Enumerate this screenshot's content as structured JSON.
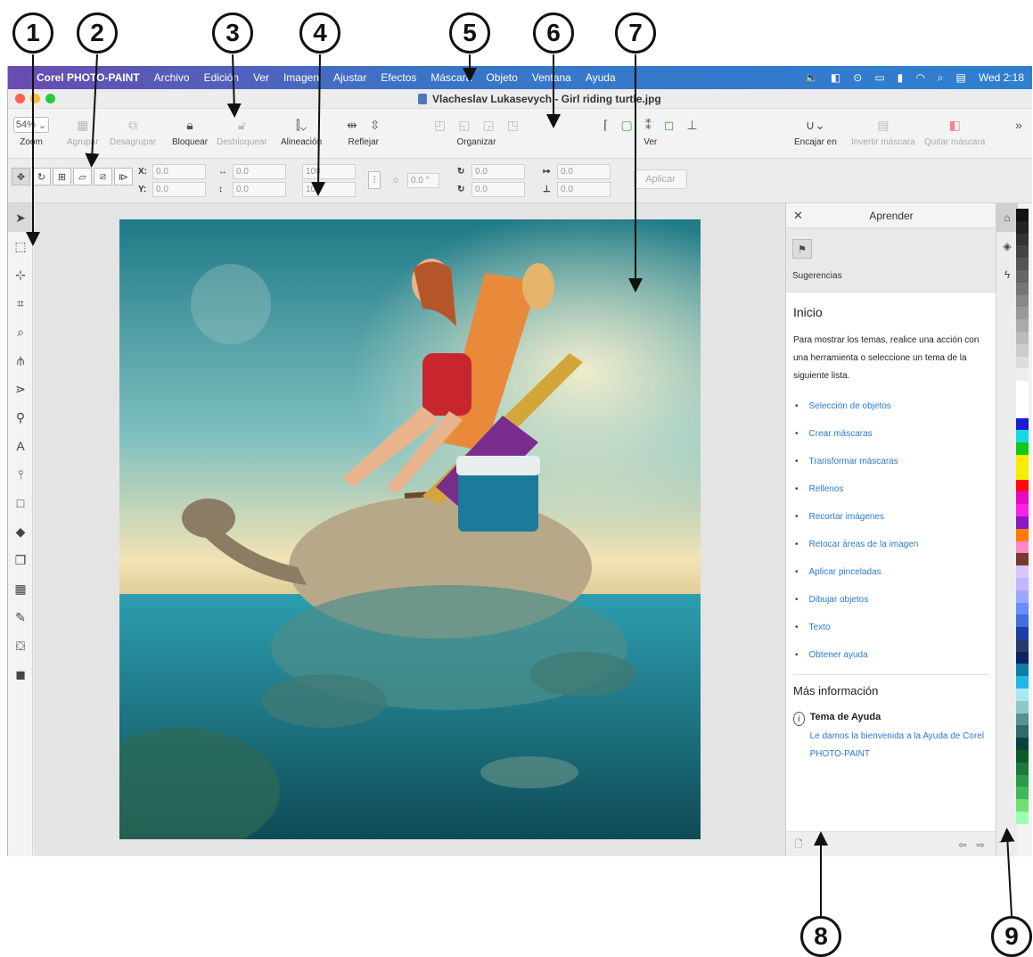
{
  "callouts": [
    "1",
    "2",
    "3",
    "4",
    "5",
    "6",
    "7",
    "8",
    "9"
  ],
  "menubar": {
    "app_name": "Corel PHOTO-PAINT",
    "items": [
      "Archivo",
      "Edición",
      "Ver",
      "Imagen",
      "Ajustar",
      "Efectos",
      "Máscara",
      "Objeto",
      "Ventana",
      "Ayuda"
    ],
    "clock": "Wed 2:18"
  },
  "titlebar": {
    "document_title": "Vlacheslav Lukasevych - Girl riding turtle.jpg"
  },
  "propbar": {
    "zoom_value": "54%",
    "zoom_label": "Zoom",
    "group_label": "Agrupar",
    "ungroup_label": "Desagrupar",
    "lock_label": "Bloquear",
    "unlock_label": "Desbloquear",
    "align_label": "Alineación",
    "mirror_label": "Reflejar",
    "arrange_label": "Organizar",
    "view_label": "Ver",
    "snap_label": "Encajar en",
    "invert_mask_label": "Invertir máscara",
    "remove_mask_label": "Quitar máscara"
  },
  "toolbar2": {
    "x_label": "X:",
    "x_value": "0.0",
    "y_label": "Y:",
    "y_value": "0.0",
    "w_value": "0.0",
    "h_value": "0.0",
    "sw_value": "100",
    "sh_value": "100",
    "angle_value": "0.0 °",
    "rx_value": "0.0",
    "ry_value": "0.0",
    "sx_value": "0.0",
    "sy_value": "0.0",
    "apply_label": "Aplicar"
  },
  "dock": {
    "title": "Aprender",
    "tips_label": "Sugerencias",
    "heading": "Inicio",
    "intro": "Para mostrar los temas, realice una acción con una herramienta o seleccione un tema de la siguiente lista.",
    "topics": [
      "Selección de objetos",
      "Crear máscaras",
      "Transformar máscaras",
      "Rellenos",
      "Recortar imágenes",
      "Retocar áreas de la imagen",
      "Aplicar pinceladas",
      "Dibujar objetos",
      "Texto",
      "Obtener ayuda"
    ],
    "more_heading": "Más información",
    "help_title": "Tema de Ayuda",
    "help_link": "Le damos la bienvenida a la Ayuda de Corel PHOTO-PAINT"
  },
  "colors": {
    "accent": "#3a78c5",
    "link": "#2a7ad8",
    "palette": [
      "#111111",
      "#222222",
      "#333333",
      "#444444",
      "#555555",
      "#666666",
      "#777777",
      "#888888",
      "#999999",
      "#aaaaaa",
      "#bbbbbb",
      "#cccccc",
      "#dddddd",
      "#eeeeee",
      "#ffffff",
      "#ffffff",
      "#ffffff",
      "#1b1bd8",
      "#11dbe6",
      "#15c81a",
      "#ffeb00",
      "#f0f000",
      "#ff0a0a",
      "#e80ac3",
      "#ff20e8",
      "#8a1abf",
      "#ff7a00",
      "#ff89c6",
      "#7a3b2e",
      "#d6c8ff",
      "#c4b5ff",
      "#9aa8ff",
      "#6a8cff",
      "#3f6fe0",
      "#1a3fa8",
      "#2a3a70",
      "#0d2462",
      "#0f7ca8",
      "#1fb6e8",
      "#a8e8f4",
      "#8cc8c8",
      "#5a9090",
      "#2f6b6b",
      "#0a4040",
      "#0a5a2a",
      "#1b7a3a",
      "#2b9a4a",
      "#3cba5c",
      "#6fe070",
      "#9fffb0"
    ]
  }
}
